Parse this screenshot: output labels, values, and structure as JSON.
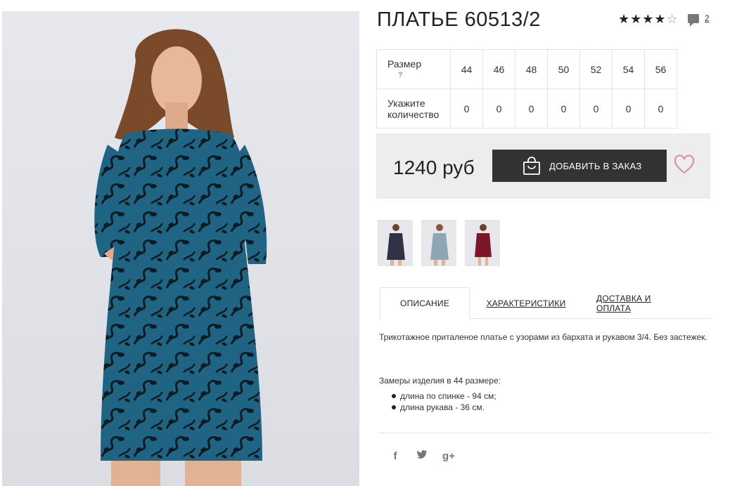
{
  "product": {
    "title": "ПЛАТЬЕ 60513/2",
    "rating_stars": 4,
    "rating_max": 5,
    "comments_count": "2"
  },
  "sizes": {
    "size_label": "Размер",
    "help_label": "?",
    "qty_label": "Укажите количество",
    "values": [
      "44",
      "46",
      "48",
      "50",
      "52",
      "54",
      "56"
    ],
    "quantities": [
      "0",
      "0",
      "0",
      "0",
      "0",
      "0",
      "0"
    ]
  },
  "purchase": {
    "price": "1240 руб",
    "add_label": "ДОБАВИТЬ В ЗАКАЗ"
  },
  "thumbnails": [
    {
      "color": "#2f3345"
    },
    {
      "color": "#8fa7b5"
    },
    {
      "color": "#7c1628"
    }
  ],
  "tabs": [
    {
      "label": "ОПИСАНИЕ"
    },
    {
      "label": "ХАРАКТЕРИСТИКИ"
    },
    {
      "label": "ДОСТАВКА И ОПЛАТА"
    }
  ],
  "description": {
    "text": "Трикотажное приталеное платье с узорами из бархата и рукавом 3/4. Без застежек.",
    "measures_title": "Замеры изделия в 44 размере:",
    "measures": [
      "длина по спинке - 94 см;",
      "длина рукава - 36 см."
    ]
  },
  "social": {
    "facebook": "f",
    "twitter": "t",
    "gplus": "g+"
  },
  "colors": {
    "accent_dark": "#333333",
    "heart": "#e08a9e",
    "dress_blue": "#1f6583"
  }
}
